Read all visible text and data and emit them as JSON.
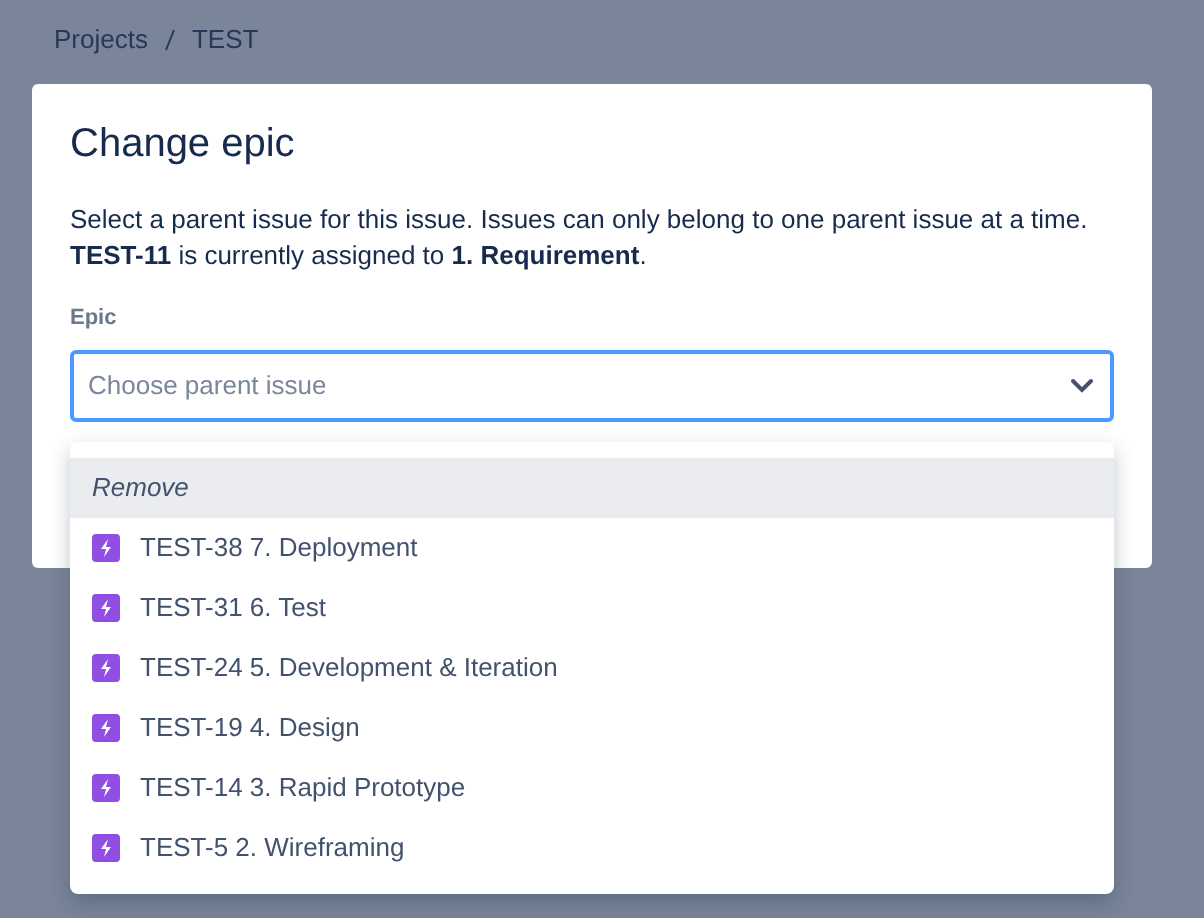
{
  "breadcrumb": [
    "Projects",
    "TEST"
  ],
  "dialog": {
    "title": "Change epic",
    "description": "Select a parent issue for this issue. Issues can only belong to one parent issue at a time. **TEST-11** is currently assigned to **1. Requirement**.",
    "field": {
      "label": "Epic",
      "placeholder": "Choose parent issue",
      "focused": true
    }
  },
  "dropdown": {
    "options": [
      {
        "kind": "remove",
        "label": "Remove",
        "selected": true
      },
      {
        "kind": "epic",
        "label": "TEST-38 7. Deployment",
        "selected": false
      },
      {
        "kind": "epic",
        "label": "TEST-31 6. Test",
        "selected": false
      },
      {
        "kind": "epic",
        "label": "TEST-24 5. Development & Iteration",
        "selected": false
      },
      {
        "kind": "epic",
        "label": "TEST-19 4. Design",
        "selected": false
      },
      {
        "kind": "epic",
        "label": "TEST-14 3. Rapid Prototype",
        "selected": false
      },
      {
        "kind": "epic",
        "label": "TEST-5 2. Wireframing",
        "selected": false
      }
    ]
  }
}
